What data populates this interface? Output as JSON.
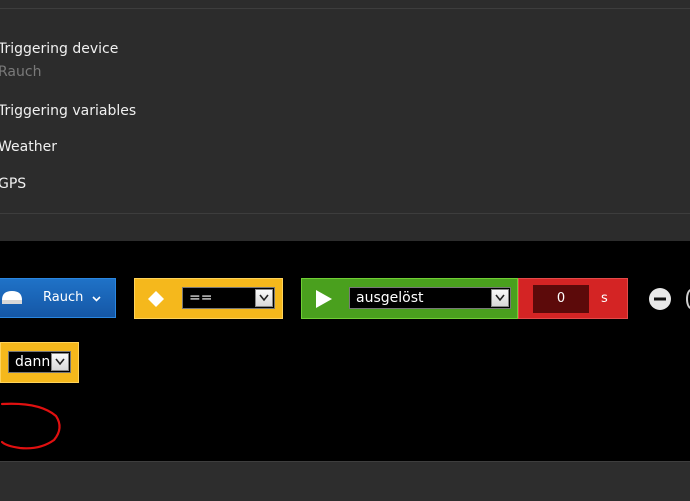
{
  "menu": {
    "triggering_device": "Triggering device",
    "triggering_device_value": "Rauch",
    "triggering_variables": "Triggering variables",
    "weather": "Weather",
    "gps": "GPS"
  },
  "rule": {
    "device": {
      "label": "Rauch",
      "color": "#1865b8"
    },
    "operator": {
      "value": "==",
      "color": "#f5b81c"
    },
    "value": {
      "value": "ausgelöst",
      "color": "#4aa01e"
    },
    "delay": {
      "value": "0",
      "unit": "s",
      "color": "#d42424"
    },
    "connector": {
      "value": "dann",
      "color": "#f5b81c"
    }
  },
  "annotation_color": "#e01010"
}
